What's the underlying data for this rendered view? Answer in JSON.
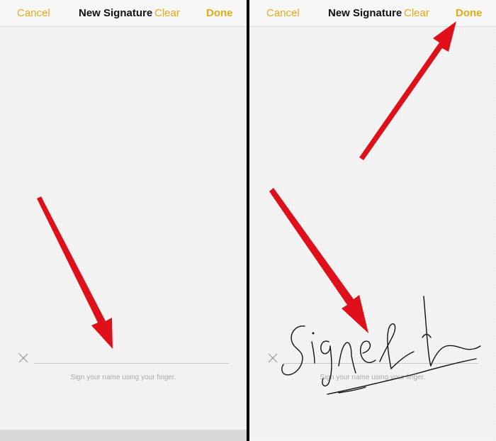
{
  "panels": [
    {
      "nav": {
        "cancel": "Cancel",
        "title": "New Signature",
        "clear": "Clear",
        "done": "Done"
      },
      "hint": "Sign your name using your finger."
    },
    {
      "nav": {
        "cancel": "Cancel",
        "title": "New Signature",
        "clear": "Clear",
        "done": "Done"
      },
      "hint": "Sign your name using your finger."
    }
  ],
  "colors": {
    "accent": "#e5aa17",
    "arrow": "#e0101a",
    "ink": "#111111"
  },
  "icons": [
    "close-icon",
    "arrow-annotation"
  ]
}
